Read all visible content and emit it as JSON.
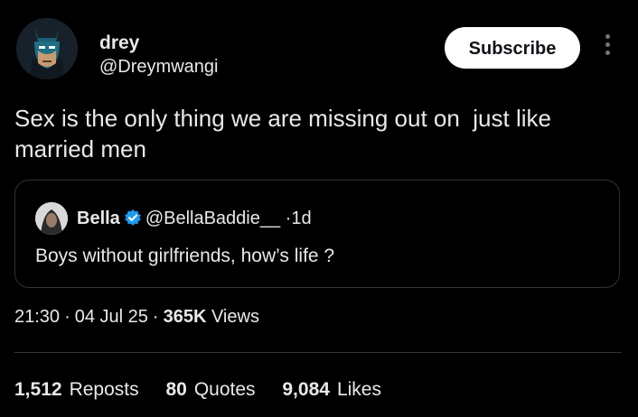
{
  "author": {
    "display_name": "drey",
    "handle": "@Dreymwangi",
    "avatar_icon": "batman-avatar-icon"
  },
  "actions": {
    "subscribe_label": "Subscribe",
    "more_icon": "more-vertical-icon"
  },
  "tweet": {
    "text": "Sex is the only thing we are missing out on  just like married men"
  },
  "quoted": {
    "display_name": "Bella",
    "verified_icon": "verified-badge-icon",
    "handle": "@BellaBaddie__",
    "dot": "·",
    "time": "1d",
    "text": "Boys without girlfriends, how’s life ?"
  },
  "meta": {
    "time": "21:30",
    "dot": "·",
    "date": "04 Jul 25",
    "views_count": "365K",
    "views_label": "Views"
  },
  "stats": {
    "reposts_count": "1,512",
    "reposts_label": "Reposts",
    "quotes_count": "80",
    "quotes_label": "Quotes",
    "likes_count": "9,084",
    "likes_label": "Likes"
  },
  "colors": {
    "background": "#000000",
    "text": "#e7e9ea",
    "verified": "#1d9bf0",
    "border": "#2f3336"
  }
}
